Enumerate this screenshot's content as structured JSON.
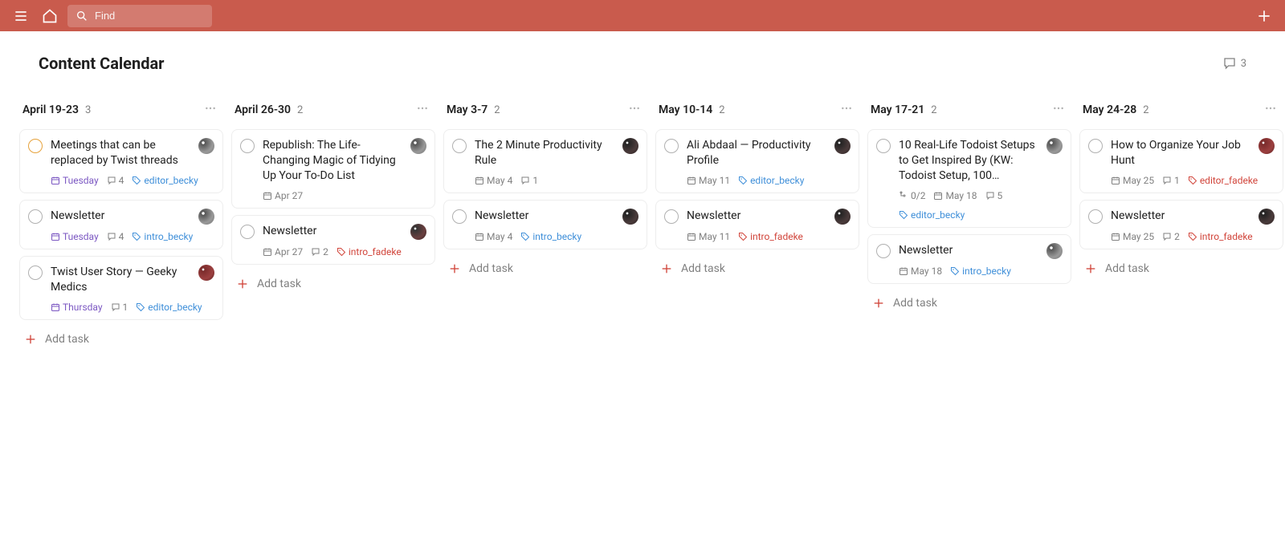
{
  "topbar": {
    "search_placeholder": "Find"
  },
  "header": {
    "title": "Content Calendar",
    "comments": 3
  },
  "add_task_label": "Add task",
  "columns": [
    {
      "title": "April 19-23",
      "count": 3,
      "cards": [
        {
          "title": "Meetings that can be replaced by Twist threads",
          "priority": "p3",
          "avatar": "a1",
          "date": {
            "text": "Tuesday",
            "style": "purple",
            "icon": "calendar"
          },
          "comments": 4,
          "tag": {
            "text": "editor_becky",
            "style": "blue"
          }
        },
        {
          "title": "Newsletter",
          "avatar": "a1",
          "date": {
            "text": "Tuesday",
            "style": "purple",
            "icon": "calendar"
          },
          "comments": 4,
          "tag": {
            "text": "intro_becky",
            "style": "blue"
          }
        },
        {
          "title": "Twist User Story — Geeky Medics",
          "avatar": "a3",
          "date": {
            "text": "Thursday",
            "style": "purple",
            "icon": "calendar"
          },
          "comments": 1,
          "tag": {
            "text": "editor_becky",
            "style": "blue"
          }
        }
      ]
    },
    {
      "title": "April 26-30",
      "count": 2,
      "cards": [
        {
          "title": "Republish: The Life-Changing Magic of Tidying Up Your To-Do List",
          "avatar": "a1",
          "date": {
            "text": "Apr 27",
            "style": "",
            "icon": "calendar-grey"
          }
        },
        {
          "title": "Newsletter",
          "avatar": "a4",
          "date": {
            "text": "Apr 27",
            "style": "",
            "icon": "calendar-grey"
          },
          "comments": 2,
          "tag": {
            "text": "intro_fadeke",
            "style": "red"
          }
        }
      ]
    },
    {
      "title": "May 3-7",
      "count": 2,
      "cards": [
        {
          "title": "The 2 Minute Productivity Rule",
          "avatar": "a2",
          "date": {
            "text": "May 4",
            "style": "",
            "icon": "calendar-grey"
          },
          "comments": 1
        },
        {
          "title": "Newsletter",
          "avatar": "a2",
          "date": {
            "text": "May 4",
            "style": "",
            "icon": "calendar-grey"
          },
          "tag": {
            "text": "intro_becky",
            "style": "blue"
          }
        }
      ]
    },
    {
      "title": "May 10-14",
      "count": 2,
      "cards": [
        {
          "title": "Ali Abdaal — Productivity Profile",
          "avatar": "a2",
          "date": {
            "text": "May 11",
            "style": "",
            "icon": "calendar-grey"
          },
          "tag": {
            "text": "editor_becky",
            "style": "blue"
          }
        },
        {
          "title": "Newsletter",
          "avatar": "a2",
          "date": {
            "text": "May 11",
            "style": "",
            "icon": "calendar-grey"
          },
          "tag": {
            "text": "intro_fadeke",
            "style": "red"
          }
        }
      ]
    },
    {
      "title": "May 17-21",
      "count": 2,
      "cards": [
        {
          "title": "10 Real-Life Todoist Setups to Get Inspired By (KW: Todoist Setup, 100…",
          "avatar": "a1",
          "subtasks": "0/2",
          "date": {
            "text": "May 18",
            "style": "",
            "icon": "calendar-grey"
          },
          "comments": 5,
          "tag": {
            "text": "editor_becky",
            "style": "blue"
          }
        },
        {
          "title": "Newsletter",
          "avatar": "a1",
          "date": {
            "text": "May 18",
            "style": "",
            "icon": "calendar-grey"
          },
          "tag": {
            "text": "intro_becky",
            "style": "blue"
          }
        }
      ]
    },
    {
      "title": "May 24-28",
      "count": 2,
      "cards": [
        {
          "title": "How to Organize Your Job Hunt",
          "avatar": "a3",
          "date": {
            "text": "May 25",
            "style": "",
            "icon": "calendar-grey"
          },
          "comments": 1,
          "tag": {
            "text": "editor_fadeke",
            "style": "red"
          }
        },
        {
          "title": "Newsletter",
          "avatar": "a2",
          "date": {
            "text": "May 25",
            "style": "",
            "icon": "calendar-grey"
          },
          "comments": 2,
          "tag": {
            "text": "intro_fadeke",
            "style": "red"
          }
        }
      ]
    }
  ]
}
